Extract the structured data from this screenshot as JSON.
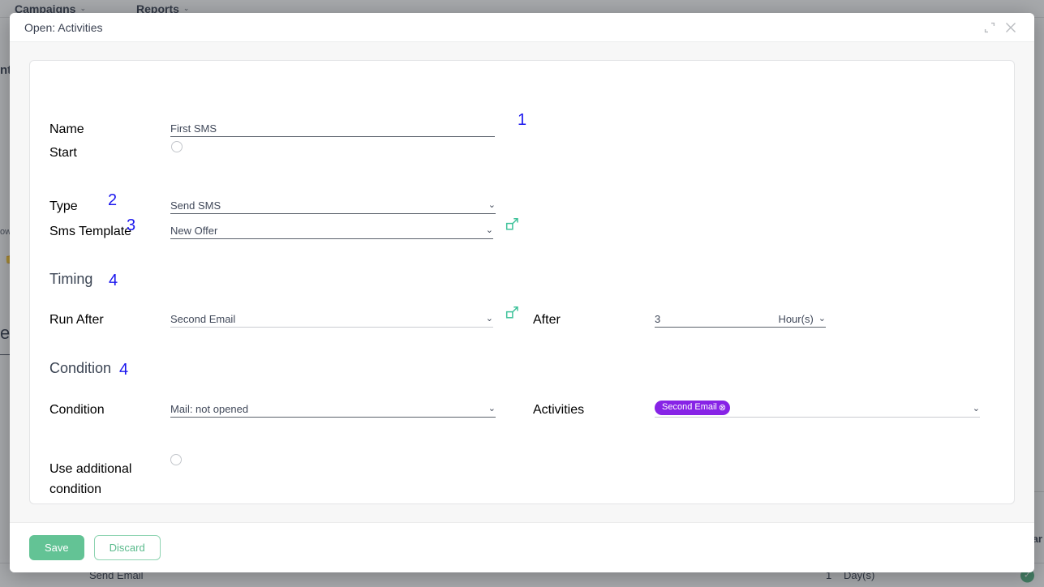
{
  "background": {
    "nav": [
      {
        "label": "Campaigns",
        "caret": "⌄"
      },
      {
        "label": "Reports",
        "caret": "⌄"
      }
    ],
    "left_fragment_top": "nt",
    "left_fragment_how": "ow",
    "left_fragment_er": "er",
    "thumb_icon": "thumbs-up-icon",
    "right_fragment": "tar",
    "bottom_row": {
      "cell_1": "Send Email",
      "cell_2": "1",
      "cell_3": "Day(s)",
      "status_icon": "✓"
    }
  },
  "dialog": {
    "title": "Open: Activities",
    "header_buttons": {
      "expand": "expand-icon",
      "close": "close-icon"
    },
    "footer": {
      "save_label": "Save",
      "discard_label": "Discard"
    }
  },
  "form": {
    "name": {
      "label": "Name",
      "value": "First SMS",
      "annotation": "1"
    },
    "start": {
      "label": "Start",
      "checked": false
    },
    "type": {
      "label": "Type",
      "value": "Send SMS",
      "annotation": "2",
      "chevron": "⌄"
    },
    "sms_template": {
      "label": "Sms Template",
      "value": "New Offer",
      "annotation": "3",
      "chevron": "⌄",
      "external_link": "external-link-icon"
    },
    "timing": {
      "title": "Timing",
      "annotation": "4",
      "run_after": {
        "label": "Run After",
        "value": "Second Email",
        "chevron": "⌄",
        "external_link": "external-link-icon"
      },
      "after": {
        "label": "After",
        "value": "3",
        "unit": "Hour(s)",
        "chevron": "⌄"
      }
    },
    "condition_section": {
      "title": "Condition",
      "annotation": "4",
      "condition": {
        "label": "Condition",
        "value": "Mail: not opened",
        "chevron": "⌄"
      },
      "activities": {
        "label": "Activities",
        "tags": [
          {
            "label": "Second Email",
            "remove": "⊗"
          }
        ],
        "chevron": "⌄"
      },
      "use_additional": {
        "label_line1": "Use additional",
        "label_line2": "condition",
        "checked": false
      }
    }
  },
  "colors": {
    "accent_green": "#63c395",
    "tag_purple": "#8723e6",
    "annotation_blue": "#1b17ee",
    "link_teal": "#3ec29a"
  }
}
